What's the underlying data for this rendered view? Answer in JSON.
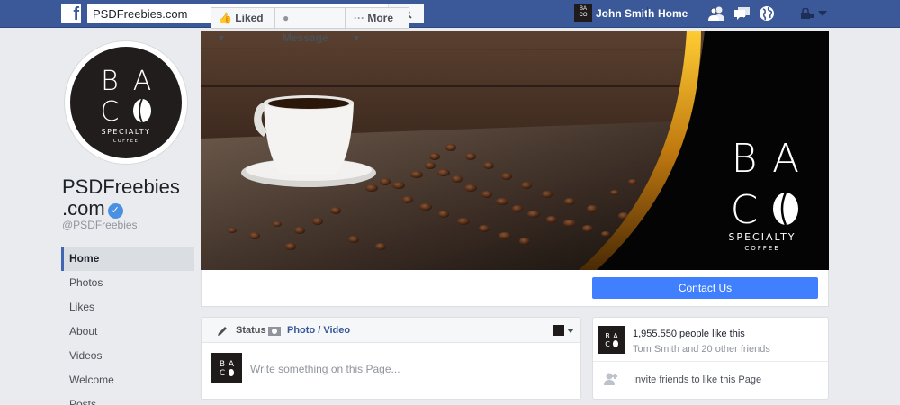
{
  "topbar": {
    "search_value": "PSDFreebies.com",
    "user_name": "John Smith",
    "home_label": "Home"
  },
  "brand": {
    "logo_lines": [
      "B A",
      "C O",
      "SPECIALTY",
      "COFFEE"
    ],
    "colors": {
      "fb_blue": "#3b5998",
      "accent": "#4080ff",
      "dark": "#1e1b1a"
    }
  },
  "page": {
    "name_line1": "PSDFreebies",
    "name_line2": ".com",
    "handle": "@PSDFreebies"
  },
  "nav": [
    "Home",
    "Photos",
    "Likes",
    "About",
    "Videos",
    "Welcome",
    "Posts"
  ],
  "actions": {
    "liked": "Liked",
    "message": "Message",
    "more": "More",
    "contact": "Contact Us"
  },
  "composer": {
    "status": "Status",
    "photo_video": "Photo / Video",
    "placeholder": "Write something on this Page..."
  },
  "likes_box": {
    "count_text": "1,955.550 people like this",
    "friends_text": "Tom Smith and 20 other friends",
    "invite_text": "Invite friends to like this Page"
  },
  "icons": [
    "facebook-logo-icon",
    "search-icon",
    "friend-requests-icon",
    "messages-icon",
    "globe-icon",
    "privacy-lock-icon",
    "dropdown-arrow-icon",
    "like-thumb-icon",
    "message-bubble-icon",
    "pencil-icon",
    "camera-icon",
    "add-friend-icon"
  ]
}
